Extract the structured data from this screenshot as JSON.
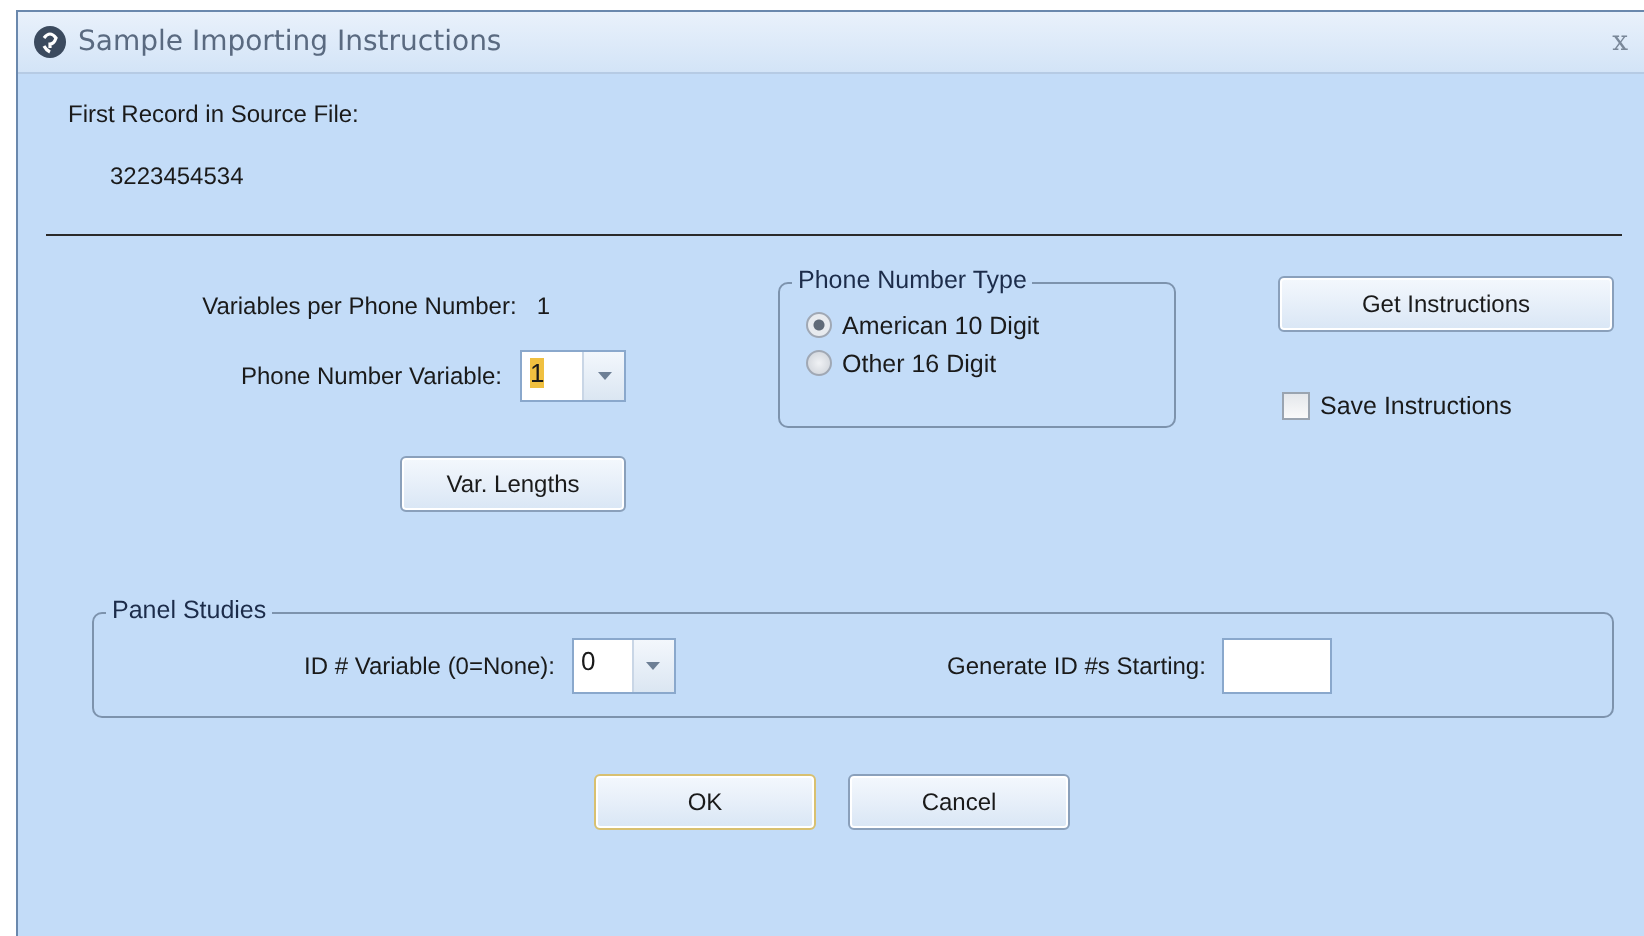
{
  "window": {
    "title": "Sample Importing Instructions",
    "close": "x"
  },
  "source": {
    "label": "First Record in Source File:",
    "value": "3223454534"
  },
  "variables_per_phone": {
    "label": "Variables per Phone Number:",
    "value": "1"
  },
  "phone_variable": {
    "label": "Phone Number Variable:",
    "value": "1"
  },
  "var_lengths_button": "Var. Lengths",
  "phone_type": {
    "title": "Phone Number Type",
    "options": [
      {
        "label": "American 10 Digit",
        "selected": true
      },
      {
        "label": "Other 16 Digit",
        "selected": false
      }
    ]
  },
  "get_instructions_button": "Get Instructions",
  "save_instructions": {
    "label": "Save Instructions",
    "checked": false
  },
  "panel_studies": {
    "title": "Panel Studies",
    "id_variable": {
      "label": "ID # Variable (0=None):",
      "value": "0"
    },
    "generate_label": "Generate ID #s Starting:"
  },
  "buttons": [
    {
      "label": "OK",
      "selected": true
    },
    {
      "label": "Cancel",
      "selected": false
    }
  ]
}
